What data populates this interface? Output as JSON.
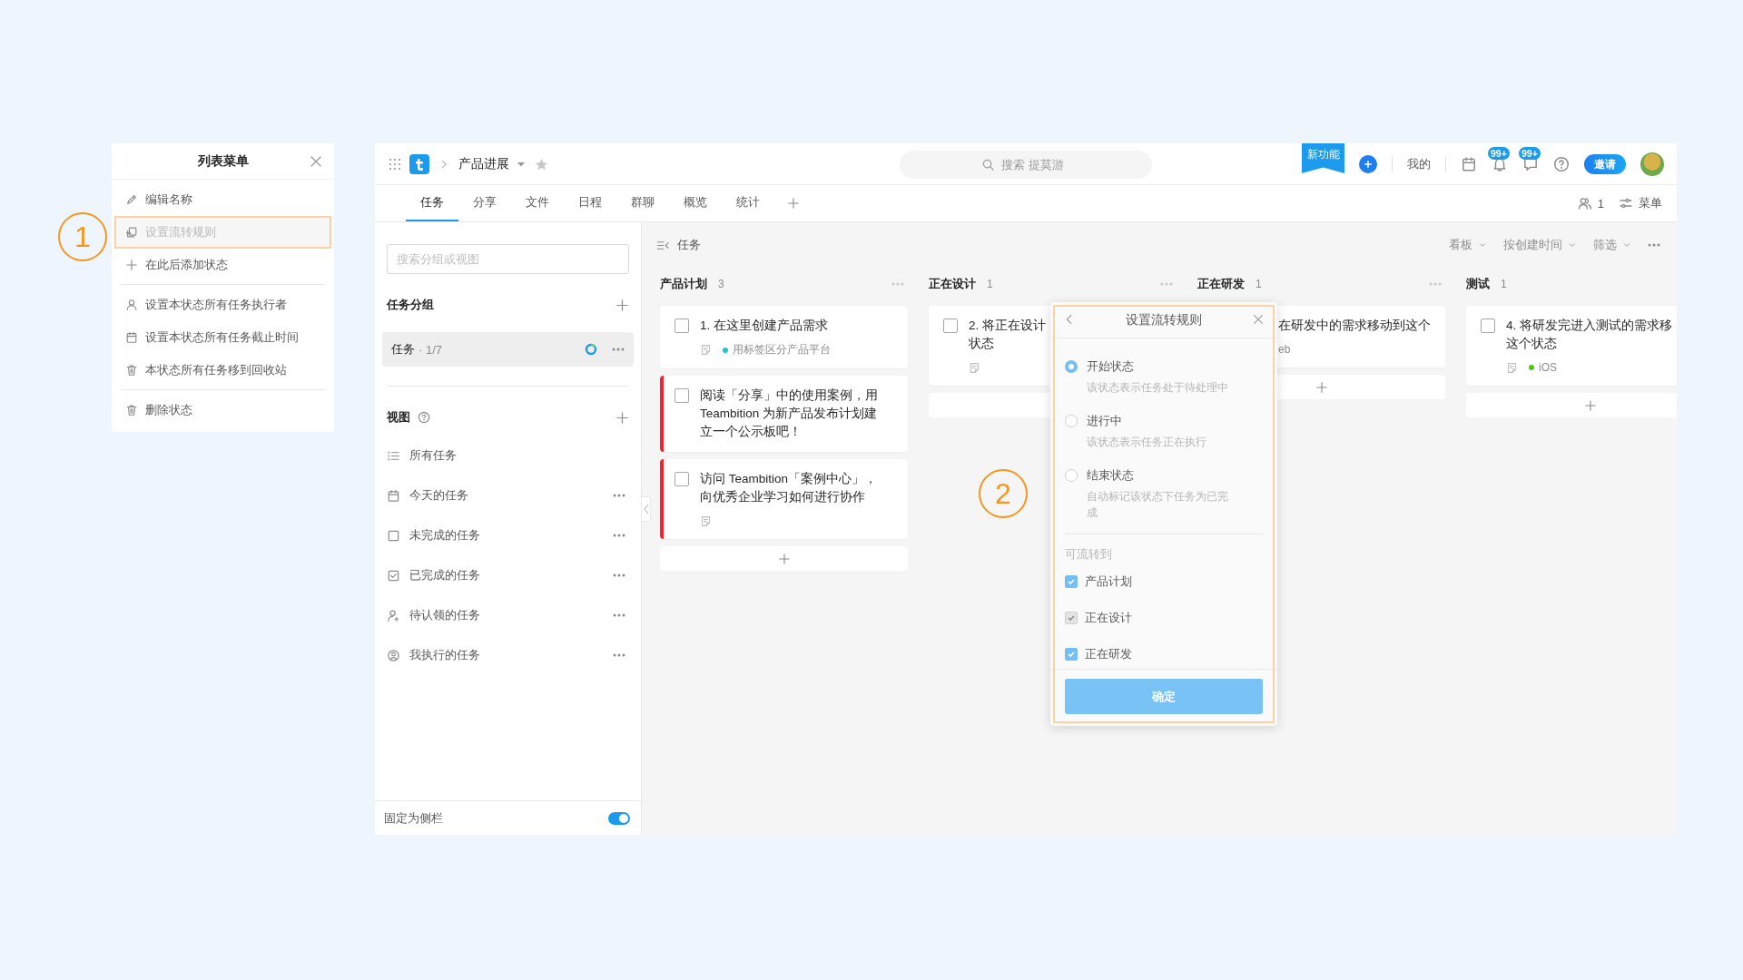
{
  "annotations": [
    {
      "label": "1"
    },
    {
      "label": "2"
    }
  ],
  "list_menu": {
    "title": "列表菜单",
    "sections": [
      {
        "items": [
          {
            "kind": "edit",
            "label": "编辑名称",
            "highlighted": false
          },
          {
            "kind": "rule",
            "label": "设置流转规则",
            "highlighted": true
          },
          {
            "kind": "add",
            "label": "在此后添加状态",
            "highlighted": false
          }
        ]
      },
      {
        "items": [
          {
            "kind": "assignee",
            "label": "设置本状态所有任务执行者",
            "highlighted": false
          },
          {
            "kind": "deadline",
            "label": "设置本状态所有任务截止时间",
            "highlighted": false
          },
          {
            "kind": "trash",
            "label": "本状态所有任务移到回收站",
            "highlighted": false
          }
        ]
      },
      {
        "items": [
          {
            "kind": "trash",
            "label": "删除状态",
            "highlighted": false
          }
        ]
      }
    ]
  },
  "topbar": {
    "project": "产品进展",
    "search": {
      "placeholder": "搜索 提莫游"
    },
    "new_feature": "新功能",
    "my": "我的",
    "notifications": "99+",
    "messages": "99+",
    "invite": "邀请"
  },
  "tabs": [
    {
      "label": "任务",
      "selected": true
    },
    {
      "label": "分享",
      "selected": false
    },
    {
      "label": "文件",
      "selected": false
    },
    {
      "label": "日程",
      "selected": false
    },
    {
      "label": "群聊",
      "selected": false
    },
    {
      "label": "概览",
      "selected": false
    },
    {
      "label": "统计",
      "selected": false
    }
  ],
  "tabs_right": {
    "members": "1",
    "menu": "菜单"
  },
  "sidebar": {
    "search": {
      "placeholder": "搜索分组或视图"
    },
    "groups_title": "任务分组",
    "groups": [
      {
        "label": "任务",
        "count": "· 1/7",
        "selected": true
      }
    ],
    "views_title": "视图",
    "views": [
      {
        "kind": "list",
        "label": "所有任务",
        "more": false
      },
      {
        "kind": "calendar",
        "label": "今天的任务",
        "more": true
      },
      {
        "kind": "todo",
        "label": "未完成的任务",
        "more": true
      },
      {
        "kind": "done",
        "label": "已完成的任务",
        "more": true
      },
      {
        "kind": "unclaimed",
        "label": "待认领的任务",
        "more": true
      },
      {
        "kind": "mine",
        "label": "我执行的任务",
        "more": true
      }
    ],
    "pin": {
      "label": "固定为侧栏",
      "on": true
    }
  },
  "board": {
    "title": "任务",
    "controls": [
      {
        "label": "看板"
      },
      {
        "label": "按创建时间"
      },
      {
        "label": "筛选"
      }
    ],
    "columns": [
      {
        "name": "产品计划",
        "count": "3",
        "cards": [
          {
            "lines": [
              "1. 在这里创建产品需求"
            ],
            "done": false,
            "note": true,
            "tag": {
              "text": "用标签区分产品平台",
              "color": "#1bc6c6"
            }
          },
          {
            "lines": [
              "阅读「分享」中的使用案例，用",
              "Teambition 为新产品发布计划建",
              "立一个公示板吧！"
            ],
            "done": false,
            "note": false,
            "color": "#f5222d"
          },
          {
            "lines": [
              "访问 Teambition「案例中心」，",
              "向优秀企业学习如何进行协作"
            ],
            "done": false,
            "note": true,
            "color": "#f5222d"
          }
        ]
      },
      {
        "name": "正在设计",
        "count": "1",
        "cards": [
          {
            "lines": [
              "2. 将正在设计",
              "状态"
            ],
            "done": false,
            "note": true
          }
        ]
      },
      {
        "name": "正在研发",
        "count": "1",
        "cards": [
          {
            "lines": [
              "在研发中的需求移动到这个"
            ],
            "tag": {
              "text": "eb"
            }
          }
        ]
      },
      {
        "name": "测试",
        "count": "1",
        "cards": [
          {
            "lines": [
              "4. 将研发完进入测试的需求移",
              "这个状态"
            ],
            "done": false,
            "note": true,
            "tag": {
              "text": "iOS",
              "color": "#52c41a"
            }
          }
        ]
      }
    ]
  },
  "flow_rule_dialog": {
    "title": "设置流转规则",
    "highlighted": true,
    "states": [
      {
        "label": "开始状态",
        "desc": "该状态表示任务处于待处理中",
        "selected": true
      },
      {
        "label": "进行中",
        "desc": "该状态表示任务正在执行",
        "selected": false
      },
      {
        "label": "结束状态",
        "desc": "自动标记该状态下任务为已完成",
        "selected": false
      }
    ],
    "targets_label": "可流转到",
    "targets": [
      {
        "label": "产品计划",
        "checked": true,
        "disabled": false
      },
      {
        "label": "正在设计",
        "checked": true,
        "disabled": true
      },
      {
        "label": "正在研发",
        "checked": true,
        "disabled": false
      }
    ],
    "confirm": "确定"
  }
}
